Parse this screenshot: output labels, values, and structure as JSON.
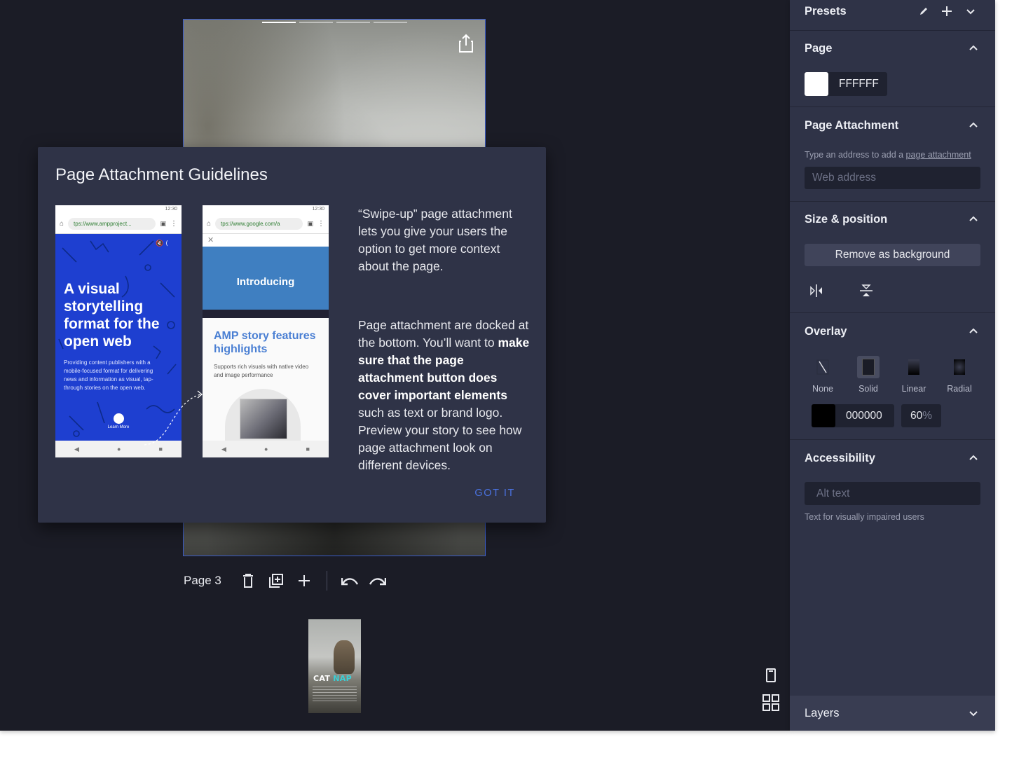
{
  "editor": {
    "page_label": "Page 3",
    "thumbnail": {
      "title_part1": "CAT",
      "title_part2": "NAP"
    }
  },
  "modal": {
    "title": "Page Attachment Guidelines",
    "phone1": {
      "time": "12:30",
      "url": "tps://www.ampproject...",
      "headline": "A visual storytelling format for the open web",
      "subtext": "Providing content publishers with a mobile-focused format for delivering news and information as visual, tap-through stories on the open web.",
      "learn_more": "Learn More"
    },
    "phone2": {
      "time": "12:30",
      "url": "tps://www.google.com/a",
      "video_title": "Introducing",
      "headline": "AMP story features highlights",
      "subtext": "Supports rich visuals with native video and image performance"
    },
    "paragraph1": "“Swipe-up” page attachment lets you give your users the option to get more context about the page.",
    "paragraph2": {
      "part1": "Page attachment are docked at the bottom. You’ll want to ",
      "bold": "make sure that the page attachment button does cover important elements",
      "part2": " such as text or brand logo. Preview your story to see how page attachment look on different devices."
    },
    "button_label": "GOT IT"
  },
  "sidebar": {
    "presets": {
      "title": "Presets"
    },
    "page": {
      "title": "Page",
      "color_value": "FFFFFF",
      "color_hex": "#FFFFFF"
    },
    "page_attachment": {
      "title": "Page Attachment",
      "hint_prefix": "Type an address to add a ",
      "hint_link": "page attachment",
      "placeholder": "Web address"
    },
    "size_position": {
      "title": "Size & position",
      "remove_bg_label": "Remove as background"
    },
    "overlay": {
      "title": "Overlay",
      "options": [
        "None",
        "Solid",
        "Linear",
        "Radial"
      ],
      "selected": "Solid",
      "color_value": "000000",
      "color_hex": "#000000",
      "opacity": "60",
      "opacity_unit": "%"
    },
    "accessibility": {
      "title": "Accessibility",
      "placeholder": "Alt text",
      "hint": "Text for visually impaired users"
    },
    "layers": {
      "title": "Layers"
    }
  },
  "colors": {
    "accent": "#4A72E0",
    "sidebar_bg": "#2F3347",
    "workspace_bg": "#1B1C26"
  }
}
